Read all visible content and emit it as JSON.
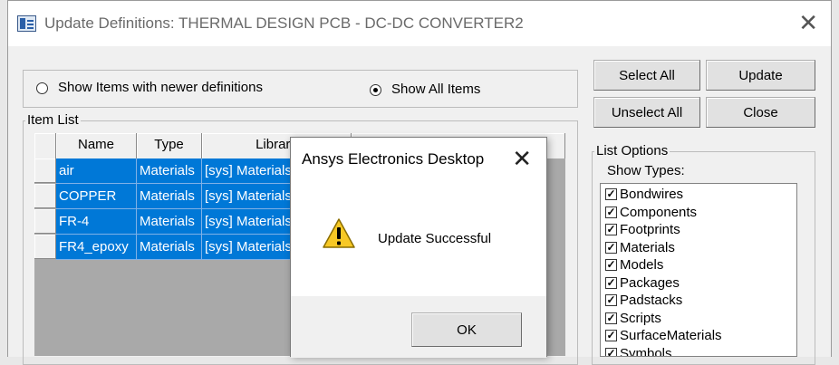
{
  "window": {
    "title": "Update Definitions: THERMAL DESIGN PCB - DC-DC CONVERTER2",
    "close_glyph": "✕"
  },
  "filter": {
    "newer_label": "Show Items with newer definitions",
    "all_label": "Show All Items",
    "selected": "all"
  },
  "buttons": {
    "select_all": "Select All",
    "update": "Update",
    "unselect_all": "Unselect All",
    "close": "Close"
  },
  "item_list": {
    "legend": "Item List",
    "columns": [
      "Name",
      "Type",
      "Library"
    ],
    "rows": [
      {
        "name": "air",
        "type": "Materials",
        "library": "[sys] Materials"
      },
      {
        "name": "COPPER",
        "type": "Materials",
        "library": "[sys] Materials"
      },
      {
        "name": "FR-4",
        "type": "Materials",
        "library": "[sys] Materials"
      },
      {
        "name": "FR4_epoxy",
        "type": "Materials",
        "library": "[sys] Materials"
      }
    ]
  },
  "list_options": {
    "legend": "List Options",
    "show_types_label": "Show Types:",
    "types": [
      {
        "label": "Bondwires",
        "checked": true
      },
      {
        "label": "Components",
        "checked": true
      },
      {
        "label": "Footprints",
        "checked": true
      },
      {
        "label": "Materials",
        "checked": true
      },
      {
        "label": "Models",
        "checked": true
      },
      {
        "label": "Packages",
        "checked": true
      },
      {
        "label": "Padstacks",
        "checked": true
      },
      {
        "label": "Scripts",
        "checked": true
      },
      {
        "label": "SurfaceMaterials",
        "checked": true
      },
      {
        "label": "Symbols",
        "checked": true
      }
    ]
  },
  "dialog": {
    "title": "Ansys Electronics Desktop",
    "close_glyph": "✕",
    "message": "Update Successful",
    "ok_label": "OK",
    "icon": "warning-icon"
  },
  "colors": {
    "selection": "#0078d7",
    "warning_yellow": "#f7c825"
  }
}
